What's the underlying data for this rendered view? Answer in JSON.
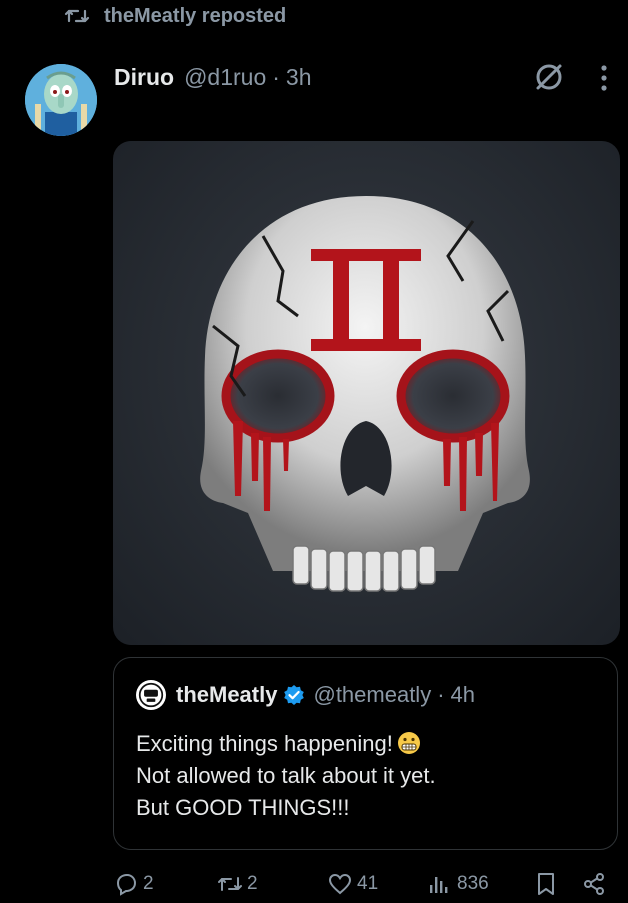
{
  "repost": {
    "text": "theMeatly reposted",
    "icon": "repost-icon"
  },
  "post": {
    "author_name": "Diruo",
    "author_handle": "@d1ruo",
    "separator": "·",
    "time": "3h",
    "avatar_icon": "avatar",
    "media_label": "skull-image-with-roman-numeral-II"
  },
  "quote": {
    "author_name": "theMeatly",
    "author_handle": "@themeatly",
    "separator": "·",
    "time": "4h",
    "lines": [
      "Exciting things happening!",
      "Not allowed to talk about it yet.",
      "But GOOD THINGS!!!"
    ]
  },
  "actions": {
    "replies": "2",
    "reposts": "2",
    "likes": "41",
    "views": "836"
  },
  "colors": {
    "background": "#000000",
    "text": "#e7e9ea",
    "muted": "#8b98a5",
    "verified": "#1d9bf0",
    "blood": "#b3141b"
  }
}
